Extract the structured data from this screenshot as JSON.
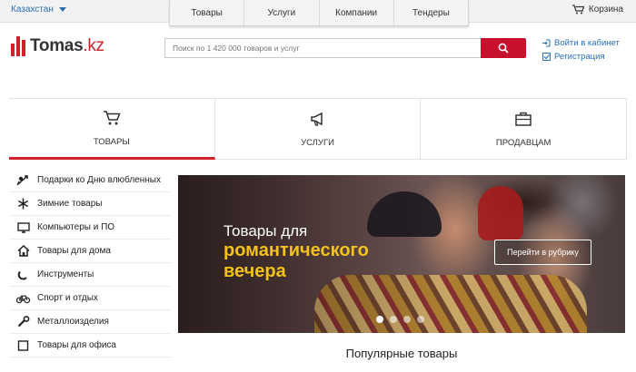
{
  "topbar": {
    "region": "Казахстан",
    "nav": [
      "Товары",
      "Услуги",
      "Компании",
      "Тендеры"
    ],
    "cart": "Корзина"
  },
  "header": {
    "logo_main": "Tomas",
    "logo_domain": ".kz",
    "search_placeholder": "Поиск по 1 420 000 товаров и услуг",
    "login": "Войти в кабинет",
    "register": "Регистрация"
  },
  "tabs": [
    {
      "label": "ТОВАРЫ",
      "icon": "cart-icon",
      "active": true
    },
    {
      "label": "УСЛУГИ",
      "icon": "megaphone-icon",
      "active": false
    },
    {
      "label": "ПРОДАВЦАМ",
      "icon": "briefcase-icon",
      "active": false
    }
  ],
  "sidebar": {
    "items": [
      {
        "label": "Подарки ко Дню влюбленных",
        "icon": "cupid-icon"
      },
      {
        "label": "Зимние товары",
        "icon": "snowflake-icon"
      },
      {
        "label": "Компьютеры и ПО",
        "icon": "monitor-icon"
      },
      {
        "label": "Товары для дома",
        "icon": "house-icon"
      },
      {
        "label": "Инструменты",
        "icon": "magnet-icon"
      },
      {
        "label": "Спорт и отдых",
        "icon": "bicycle-icon"
      },
      {
        "label": "Металлоизделия",
        "icon": "wrench-icon"
      },
      {
        "label": "Товары для офиса",
        "icon": "office-icon"
      }
    ]
  },
  "banner": {
    "line1": "Товары для",
    "line2": "романтического",
    "line3": "вечера",
    "cta": "Перейти в рубрику",
    "slides": 4,
    "active_slide": 1
  },
  "popular_title": "Популярные товары",
  "colors": {
    "accent": "#d0202a",
    "link": "#2a6fb8",
    "highlight": "#f3c21b"
  }
}
